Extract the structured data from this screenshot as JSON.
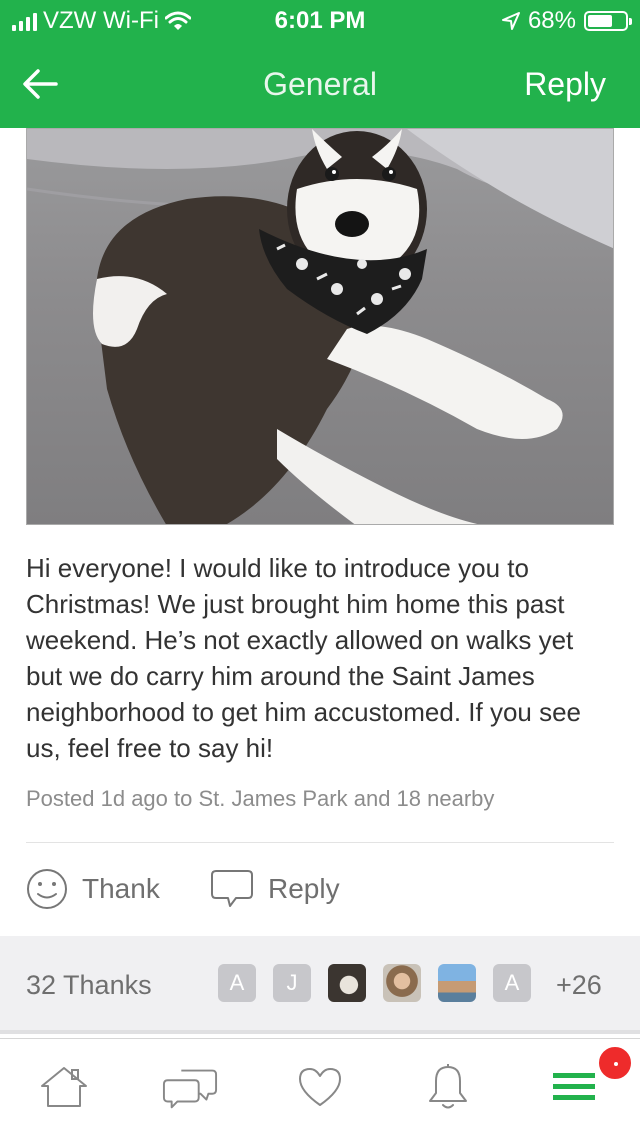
{
  "status_bar": {
    "carrier": "VZW Wi-Fi",
    "time": "6:01 PM",
    "battery_percent": "68%",
    "battery_level": 0.68,
    "icons": [
      "signal-icon",
      "wifi-icon",
      "location-arrow-icon",
      "battery-icon"
    ]
  },
  "nav": {
    "back_icon": "back-arrow-icon",
    "title": "General",
    "reply_label": "Reply"
  },
  "post": {
    "photo": "puppy-photo",
    "body": "Hi everyone! I would like to introduce you to Christmas! We just brought him home this past weekend. He’s not exactly allowed on walks yet but we do carry him around the Saint James neighborhood to get him accustomed. If you see us, feel free to say hi!",
    "meta": "Posted 1d ago to St. James Park and 18 nearby"
  },
  "actions": {
    "thank_label": "Thank",
    "reply_label": "Reply"
  },
  "thanks": {
    "count_label": "32 Thanks",
    "avatars": [
      "A",
      "J",
      "",
      "",
      "",
      "A"
    ],
    "more_label": "+26"
  },
  "tab_bar": {
    "items": [
      "home-icon",
      "messages-icon",
      "heart-icon",
      "bell-icon",
      "menu-icon"
    ],
    "accent_color": "#22b24c",
    "badge_color": "#ee2b2b"
  },
  "colors": {
    "brand_green": "#22b24c",
    "text": "#333333",
    "muted": "#8c8c8c"
  }
}
